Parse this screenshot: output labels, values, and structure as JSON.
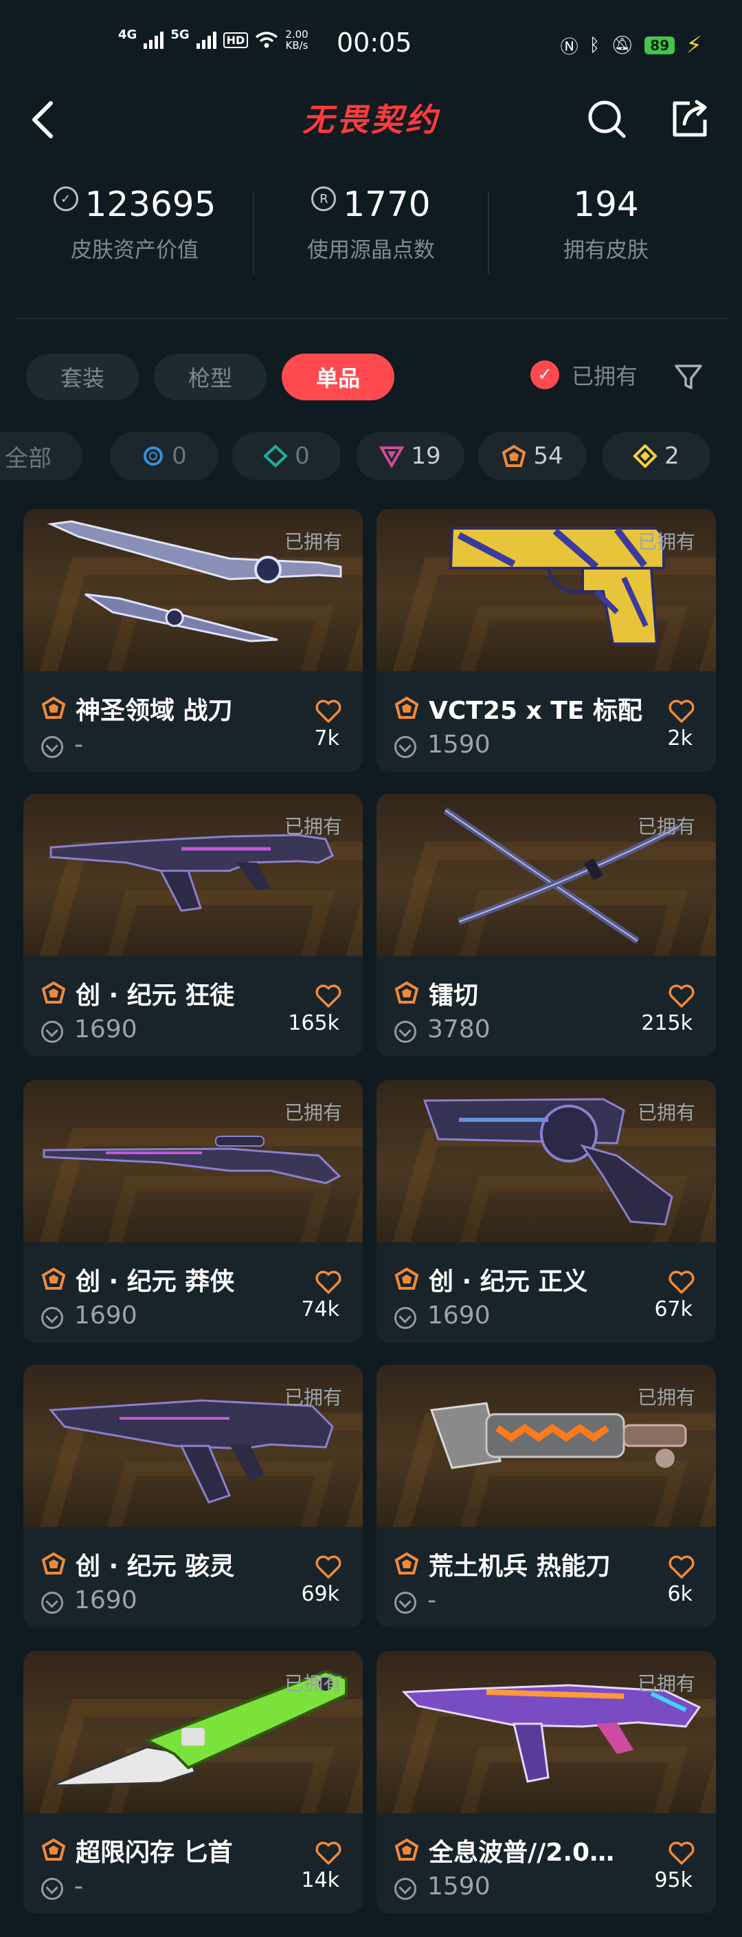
{
  "status_bar": {
    "network1": "4G",
    "network2": "5G",
    "hd": "HD",
    "speed": "2.00",
    "speed_unit": "KB/s",
    "time": "00:05",
    "battery": "89"
  },
  "header": {
    "title": "无畏契约"
  },
  "stats": [
    {
      "value": "123695",
      "label": "皮肤资产价值",
      "icon": "vp-coin-icon"
    },
    {
      "value": "1770",
      "label": "使用源晶点数",
      "icon": "radianite-icon"
    },
    {
      "value": "194",
      "label": "拥有皮肤",
      "icon": ""
    }
  ],
  "tabs": {
    "bundle": "套装",
    "gun": "枪型",
    "single": "单品"
  },
  "owned_filter_label": "已拥有",
  "chips": [
    {
      "label": "全部",
      "count": ""
    },
    {
      "label": "",
      "count": "0",
      "tier": "select",
      "color": "#3a8fd6"
    },
    {
      "label": "",
      "count": "0",
      "tier": "deluxe",
      "color": "#1fae98"
    },
    {
      "label": "",
      "count": "19",
      "tier": "premium",
      "color": "#d04a9c"
    },
    {
      "label": "",
      "count": "54",
      "tier": "exclusive",
      "color": "#f08a38"
    },
    {
      "label": "",
      "count": "2",
      "tier": "ultra",
      "color": "#f5d242"
    }
  ],
  "owned_badge": "已拥有",
  "items": [
    {
      "name": "神圣领域 战刀",
      "price": "-",
      "likes": "7k",
      "weapon": "knife-blade"
    },
    {
      "name": "VCT25 x TE 标配",
      "price": "1590",
      "likes": "2k",
      "weapon": "pistol-gold"
    },
    {
      "name": "创 · 纪元 狂徒",
      "price": "1690",
      "likes": "165k",
      "weapon": "rifle-purple"
    },
    {
      "name": "镭切",
      "price": "3780",
      "likes": "215k",
      "weapon": "crossed-katanas"
    },
    {
      "name": "创 · 纪元 莽侠",
      "price": "1690",
      "likes": "74k",
      "weapon": "sniper-purple"
    },
    {
      "name": "创 · 纪元 正义",
      "price": "1690",
      "likes": "67k",
      "weapon": "revolver-purple"
    },
    {
      "name": "创 · 纪元 骇灵",
      "price": "1690",
      "likes": "69k",
      "weapon": "smg-purple"
    },
    {
      "name": "荒土机兵 热能刀",
      "price": "-",
      "likes": "6k",
      "weapon": "thermal-blade"
    },
    {
      "name": "超限闪存 匕首",
      "price": "-",
      "likes": "14k",
      "weapon": "green-dagger"
    },
    {
      "name": "全息波普//2.0…",
      "price": "1590",
      "likes": "95k",
      "weapon": "holo-smg"
    }
  ]
}
